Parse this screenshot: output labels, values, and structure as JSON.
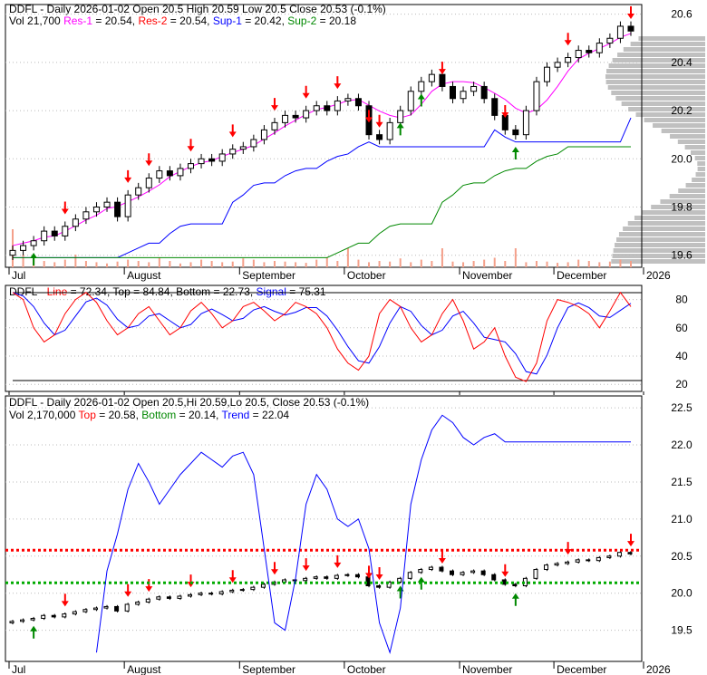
{
  "chart_data": {
    "type": "line",
    "ticker": "DDFL",
    "header1": {
      "prefix": "DDFL - Daily 2026-01-02 Open 20.5  High 20.59  Low 20.5  Close 20.53 (-0.1%)",
      "vol": "Vol 21,700 ",
      "res1": "Res-1",
      "res1_val": " = 20.54, ",
      "res2": "Res-2",
      "res2_val": " = 20.54, ",
      "sup1": "Sup-1",
      "sup1_val": " = 20.42, ",
      "sup2": "Sup-2",
      "sup2_val": " = 20.18"
    },
    "header2": {
      "prefix": "DDFL - ",
      "line": "Line",
      "line_val": " = 72.34, ",
      "top": "Top",
      "top_val": " = 84.84, ",
      "bottom": "Bottom",
      "bottom_val": " = 22.73, ",
      "signal": "Signal",
      "signal_val": " = 75.31"
    },
    "header3": {
      "prefix": "DDFL - Daily 2026-01-02 Open 20.5,Hi 20.59,Lo 20.5, Close 20.53 (-0.1%)",
      "vol": "Vol 2,170,000 ",
      "top": "Top",
      "top_val": " = 20.58, ",
      "bottom": "Bottom",
      "bottom_val": " = 20.14, ",
      "trend": "Trend",
      "trend_val": " = 22.04"
    },
    "x_labels": [
      "Jul",
      "August",
      "September",
      "October",
      "November",
      "December",
      "2026"
    ],
    "x_label_index": [
      0,
      11,
      22,
      32,
      43,
      52,
      60
    ],
    "y1_ticks": [
      "20.6",
      "20.4",
      "20.2",
      "20.0",
      "19.8",
      "19.6"
    ],
    "y1_range": [
      19.55,
      20.64
    ],
    "y2_ticks": [
      "80",
      "60",
      "40",
      "20"
    ],
    "y2_range": [
      15,
      90
    ],
    "y3_ticks": [
      "22.5",
      "22.0",
      "21.5",
      "21.0",
      "20.5",
      "20.0",
      "19.5"
    ],
    "y3_range": [
      19.08,
      22.66
    ],
    "closes": [
      19.62,
      19.64,
      19.66,
      19.7,
      19.68,
      19.72,
      19.75,
      19.78,
      19.8,
      19.82,
      19.76,
      19.85,
      19.88,
      19.92,
      19.95,
      19.93,
      19.96,
      19.98,
      20.0,
      19.99,
      20.02,
      20.04,
      20.05,
      20.08,
      20.12,
      20.15,
      20.18,
      20.17,
      20.2,
      20.22,
      20.2,
      20.24,
      20.25,
      20.22,
      20.1,
      20.08,
      20.15,
      20.2,
      20.28,
      20.32,
      20.35,
      20.3,
      20.25,
      20.28,
      20.3,
      20.25,
      20.18,
      20.12,
      20.1,
      20.2,
      20.32,
      20.38,
      20.4,
      20.42,
      20.45,
      20.44,
      20.48,
      20.5,
      20.55,
      20.53
    ],
    "volumes": [
      60,
      20,
      15,
      10,
      8,
      12,
      20,
      10,
      8,
      6,
      9,
      12,
      10,
      8,
      15,
      10,
      6,
      8,
      12,
      10,
      8,
      9,
      14,
      12,
      8,
      10,
      9,
      8,
      7,
      12,
      15,
      10,
      30,
      12,
      8,
      10,
      9,
      14,
      8,
      12,
      10,
      30,
      9,
      8,
      10,
      12,
      15,
      10,
      30,
      8,
      10,
      9,
      7,
      8,
      12,
      10,
      8,
      9,
      12,
      10
    ],
    "stoch_line": [
      85,
      80,
      60,
      50,
      55,
      70,
      80,
      85,
      78,
      65,
      55,
      60,
      70,
      75,
      65,
      55,
      60,
      72,
      78,
      70,
      60,
      65,
      75,
      78,
      72,
      65,
      70,
      78,
      75,
      70,
      60,
      45,
      35,
      30,
      40,
      70,
      80,
      75,
      60,
      50,
      55,
      70,
      80,
      65,
      45,
      50,
      60,
      40,
      25,
      22,
      35,
      65,
      80,
      78,
      75,
      70,
      60,
      72,
      85,
      75
    ],
    "trend": [
      null,
      null,
      null,
      null,
      null,
      null,
      null,
      null,
      19.2,
      20.3,
      20.8,
      21.4,
      21.75,
      21.5,
      21.2,
      21.4,
      21.6,
      21.75,
      21.9,
      21.8,
      21.7,
      21.85,
      21.9,
      21.6,
      20.6,
      19.6,
      19.5,
      20.2,
      21.2,
      21.6,
      21.4,
      21.0,
      20.9,
      21.0,
      20.6,
      19.6,
      19.2,
      19.8,
      21.2,
      21.8,
      22.2,
      22.4,
      22.3,
      22.1,
      22.0,
      22.1,
      22.15,
      22.04,
      22.04,
      22.04,
      22.04,
      22.04,
      22.04,
      22.04,
      22.04,
      22.04,
      22.04,
      22.04,
      22.04,
      22.04
    ],
    "sell_signals": [
      5,
      11,
      13,
      17,
      21,
      25,
      28,
      31,
      34,
      35,
      41,
      47,
      53,
      59
    ],
    "buy_signals": [
      2,
      37,
      39,
      48
    ],
    "top_line": 20.58,
    "bottom_line": 20.14,
    "stoch_top": 84.84,
    "stoch_bottom": 22.73,
    "colors": {
      "res1": "#ff00ff",
      "res2": "#ff0000",
      "sup1": "#0000ff",
      "sup2": "#008800",
      "up": "#ffffff",
      "down": "#000000"
    }
  }
}
